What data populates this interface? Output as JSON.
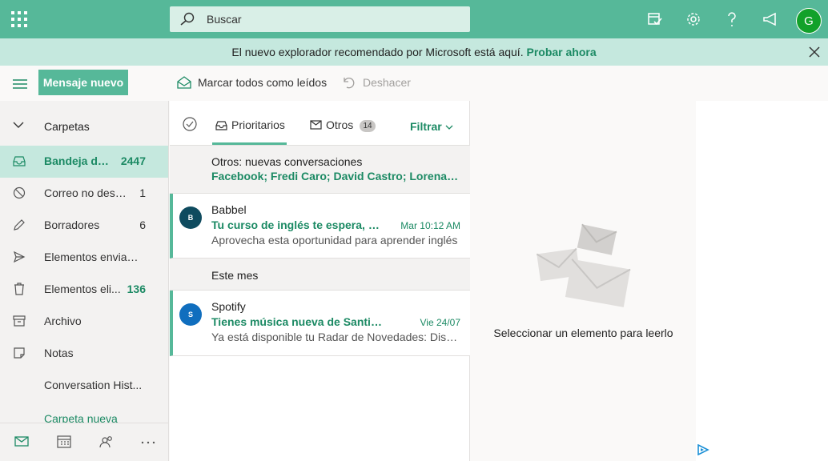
{
  "topbar": {
    "search_placeholder": "Buscar",
    "avatar_initial": "G"
  },
  "banner": {
    "text": "El nuevo explorador recomendado por Microsoft está aquí.",
    "link": "Probar ahora"
  },
  "commands": {
    "new_message": "Mensaje nuevo",
    "mark_all_read": "Marcar todos como leídos",
    "undo": "Deshacer"
  },
  "nav": {
    "folders_header": "Carpetas",
    "items": [
      {
        "label": "Bandeja de entrada",
        "display": "Bandeja de...",
        "count": "2447",
        "icon": "inbox-icon"
      },
      {
        "label": "Correo no deseado",
        "display": "Correo no dese...",
        "count": "1",
        "icon": "blocked-icon"
      },
      {
        "label": "Borradores",
        "display": "Borradores",
        "count": "6",
        "icon": "pencil-icon"
      },
      {
        "label": "Elementos enviados",
        "display": "Elementos enviad...",
        "count": "",
        "icon": "send-icon"
      },
      {
        "label": "Elementos eliminados",
        "display": "Elementos eli...",
        "count": "136",
        "icon": "trash-icon"
      },
      {
        "label": "Archivo",
        "display": "Archivo",
        "count": "",
        "icon": "archive-icon"
      },
      {
        "label": "Notas",
        "display": "Notas",
        "count": "",
        "icon": "note-icon"
      },
      {
        "label": "Conversation History",
        "display": "Conversation Hist...",
        "count": "",
        "icon": ""
      }
    ],
    "new_folder": "Carpeta nueva"
  },
  "list": {
    "tab_focused": "Prioritarios",
    "tab_other": "Otros",
    "tab_other_badge": "14",
    "filter": "Filtrar",
    "other_new": {
      "title": "Otros: nuevas conversaciones",
      "senders": "Facebook; Fredi Caro; David Castro; Lorena Caro"
    },
    "messages": [
      {
        "avatar": "B",
        "avatar_color": "#0f4b5f",
        "from": "Babbel",
        "subject": "Tu curso de inglés te espera, ahora...",
        "date": "Mar 10:12 AM",
        "preview": "Aprovecha esta oportunidad para aprender inglés"
      },
      {
        "avatar": "S",
        "avatar_color": "#106ebe",
        "from": "Spotify",
        "subject": "Tienes música nueva de Santiago...",
        "date": "Vie 24/07",
        "preview": "Ya está disponible tu Radar de Novedades: Disfruta"
      }
    ],
    "group_this_month": "Este mes"
  },
  "reading_pane": {
    "empty_text": "Seleccionar un elemento para leerlo"
  },
  "colors": {
    "accent": "#56b899",
    "accent_text": "#1c8a64",
    "banner_bg": "#c5e8de"
  }
}
